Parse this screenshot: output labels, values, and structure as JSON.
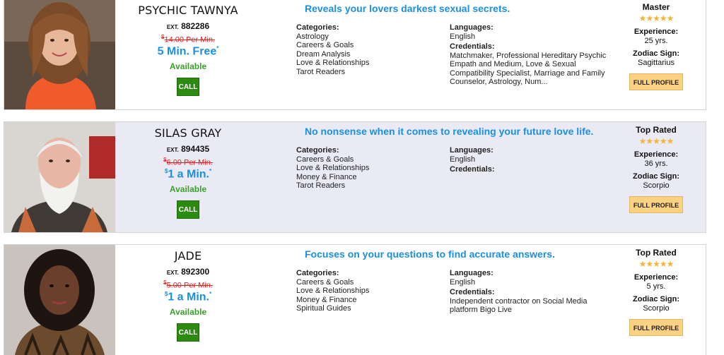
{
  "advisors": [
    {
      "name": "PSYCHIC TAWNYA",
      "ext_prefix": "EXT.",
      "ext": "882286",
      "old_price": "14.00 Per Min.",
      "price_currency": "$",
      "promo": "5 Min. Free",
      "promo_prefix": "",
      "promo_asterisk": "*",
      "status": "Available",
      "call_label": "CALL",
      "tagline": "Reveals your lovers darkest sexual secrets.",
      "categories_label": "Categories:",
      "categories": [
        "Astrology",
        "Careers & Goals",
        "Dream Analysis",
        "Love & Relationships",
        "Tarot Readers"
      ],
      "languages_label": "Languages:",
      "languages": "English",
      "credentials_label": "Credentials:",
      "credentials": "Matchmaker, Professional Hereditary Psychic Empath and Medium, Love & Sexual Compatibility Specialist, Marriage and Family Counselor, Astrology, Num...",
      "rank": "Master",
      "rating": 5,
      "experience_label": "Experience:",
      "experience": "25 yrs.",
      "zodiac_label": "Zodiac Sign:",
      "zodiac": "Sagittarius",
      "profile_label": "FULL PROFILE"
    },
    {
      "name": "SILAS GRAY",
      "ext_prefix": "EXT.",
      "ext": "894435",
      "old_price": "6.00 Per Min.",
      "price_currency": "$",
      "promo": "1 a Min.",
      "promo_prefix": "$",
      "promo_asterisk": "*",
      "status": "Available",
      "call_label": "CALL",
      "tagline": "No nonsense when it comes to revealing your future love life.",
      "categories_label": "Categories:",
      "categories": [
        "Careers & Goals",
        "Love & Relationships",
        "Money & Finance",
        "Tarot Readers"
      ],
      "languages_label": "Languages:",
      "languages": "English",
      "credentials_label": "Credentials:",
      "credentials": "",
      "rank": "Top Rated",
      "rating": 5,
      "experience_label": "Experience:",
      "experience": "36 yrs.",
      "zodiac_label": "Zodiac Sign:",
      "zodiac": "Scorpio",
      "profile_label": "FULL PROFILE"
    },
    {
      "name": "JADE",
      "ext_prefix": "EXT.",
      "ext": "892300",
      "old_price": "5.00 Per Min.",
      "price_currency": "$",
      "promo": "1 a Min.",
      "promo_prefix": "$",
      "promo_asterisk": "*",
      "status": "Available",
      "call_label": "CALL",
      "tagline": "Focuses on your questions to find accurate answers.",
      "categories_label": "Categories:",
      "categories": [
        "Careers & Goals",
        "Love & Relationships",
        "Money & Finance",
        "Spiritual Guides"
      ],
      "languages_label": "Languages:",
      "languages": "English",
      "credentials_label": "Credentials:",
      "credentials": "Independent contractor on Social Media platform Bigo Live",
      "rank": "Top Rated",
      "rating": 5,
      "experience_label": "Experience:",
      "experience": "5 yrs.",
      "zodiac_label": "Zodiac Sign:",
      "zodiac": "Scorpio",
      "profile_label": "FULL PROFILE"
    }
  ],
  "colors": {
    "accent_blue": "#1b8fe0",
    "available_green": "#3aa02a",
    "call_green": "#2d8a10",
    "old_price_red": "#e02020",
    "star_gold": "#f3b43a",
    "profile_button": "#fbd182",
    "alt_card_bg": "#e9eaf4"
  },
  "icons": [
    "star-icon"
  ]
}
